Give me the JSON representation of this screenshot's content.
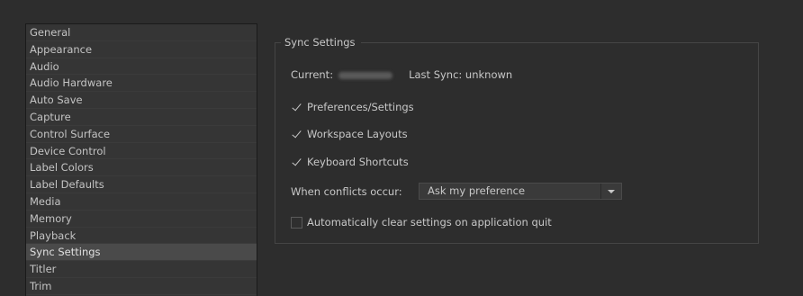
{
  "categories": [
    {
      "label": "General"
    },
    {
      "label": "Appearance"
    },
    {
      "label": "Audio"
    },
    {
      "label": "Audio Hardware"
    },
    {
      "label": "Auto Save"
    },
    {
      "label": "Capture"
    },
    {
      "label": "Control Surface"
    },
    {
      "label": "Device Control"
    },
    {
      "label": "Label Colors"
    },
    {
      "label": "Label Defaults"
    },
    {
      "label": "Media"
    },
    {
      "label": "Memory"
    },
    {
      "label": "Playback"
    },
    {
      "label": "Sync Settings",
      "selected": true
    },
    {
      "label": "Titler"
    },
    {
      "label": "Trim"
    }
  ],
  "sync": {
    "group_title": "Sync Settings",
    "current_label": "Current:",
    "last_sync": "Last Sync: unknown",
    "options": [
      {
        "label": "Preferences/Settings",
        "checked": true
      },
      {
        "label": "Workspace Layouts",
        "checked": true
      },
      {
        "label": "Keyboard Shortcuts",
        "checked": true
      }
    ],
    "conflict_label": "When conflicts occur:",
    "conflict_value": "Ask my preference",
    "auto_clear_label": "Automatically clear settings on application quit",
    "auto_clear_checked": false
  }
}
